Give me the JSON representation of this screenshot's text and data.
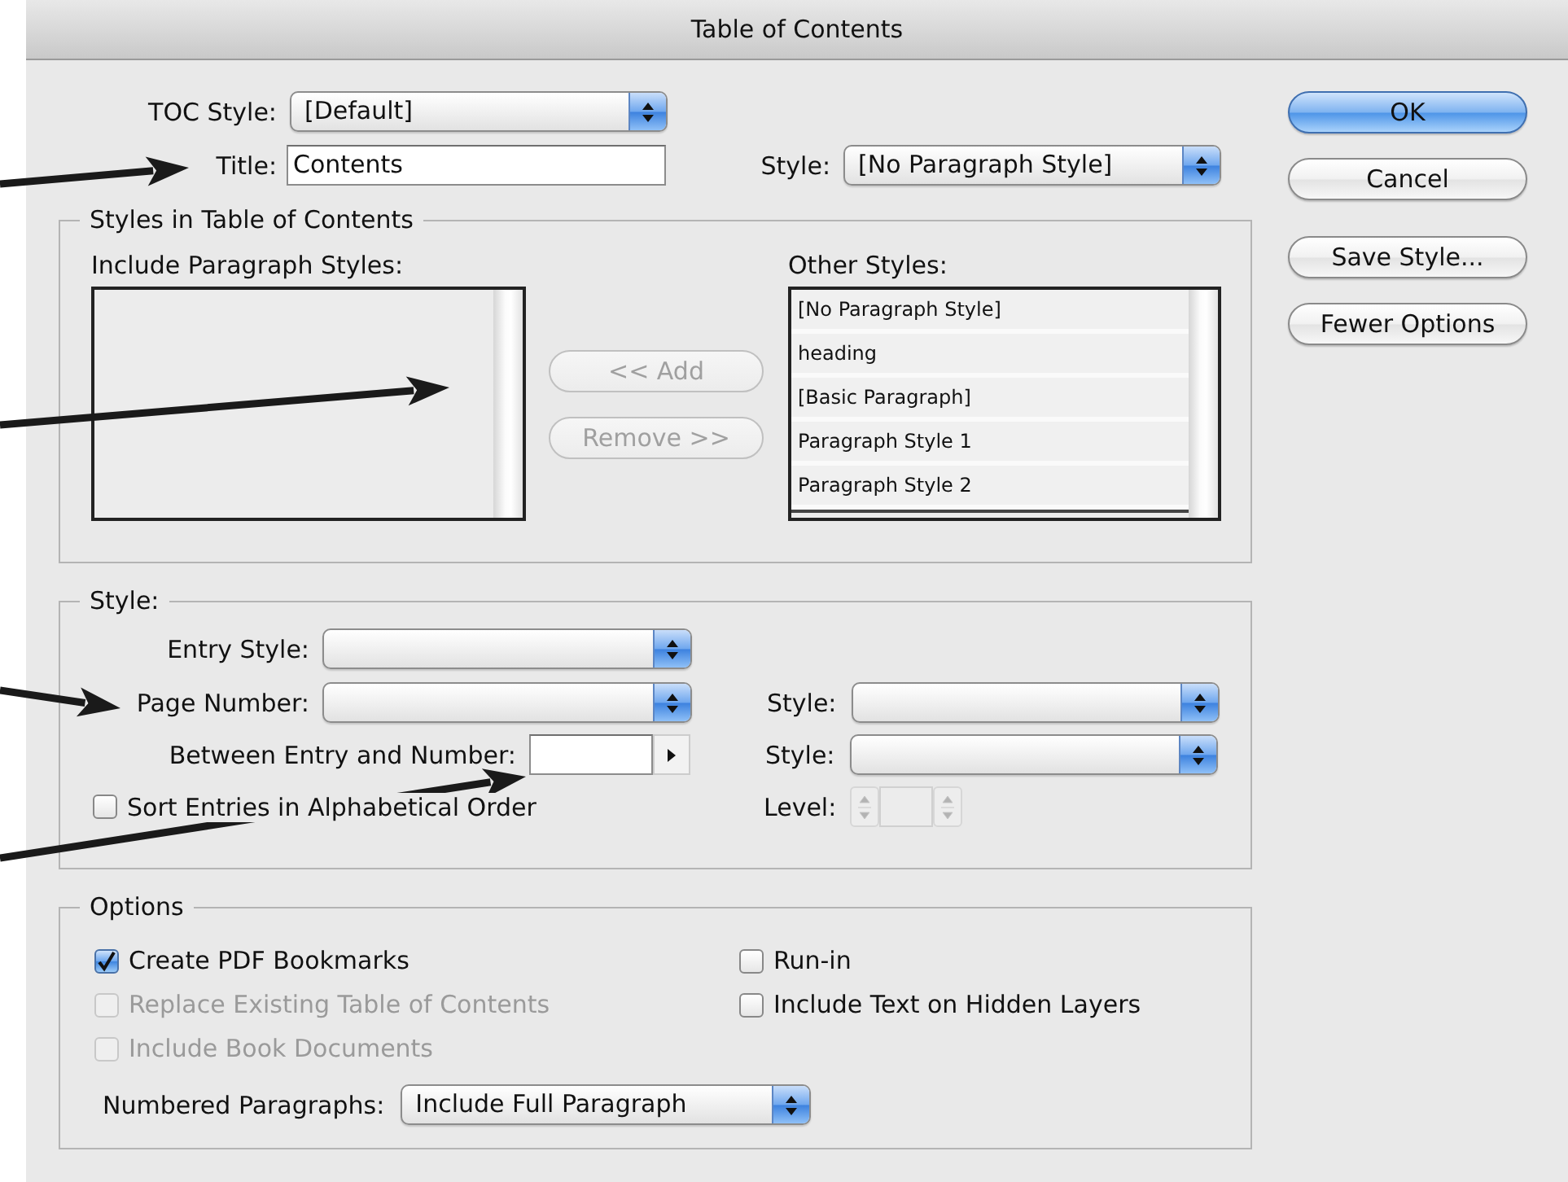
{
  "window": {
    "title": "Table of Contents"
  },
  "toc_style": {
    "label": "TOC Style:",
    "value": "[Default]"
  },
  "title": {
    "label": "Title:",
    "value": "Contents"
  },
  "title_style": {
    "label": "Style:",
    "value": "[No Paragraph Style]"
  },
  "buttons": [
    {
      "label": "OK",
      "default": true
    },
    {
      "label": "Cancel",
      "default": false
    },
    {
      "label": "Save Style...",
      "default": false
    },
    {
      "label": "Fewer Options",
      "default": false
    }
  ],
  "styles_group": {
    "title": "Styles in Table of Contents",
    "include_label": "Include Paragraph Styles:",
    "move_buttons": [
      {
        "label": "<< Add",
        "disabled": true
      },
      {
        "label": "Remove >>",
        "disabled": true
      }
    ],
    "other_label": "Other Styles:",
    "other_items": [
      {
        "label": "[No Paragraph Style]",
        "selected": false
      },
      {
        "label": "heading",
        "selected": false
      },
      {
        "label": "[Basic Paragraph]",
        "selected": false
      },
      {
        "label": "Paragraph Style 1",
        "selected": false
      },
      {
        "label": "Paragraph Style 2",
        "selected": false
      }
    ]
  },
  "style_group": {
    "title": "Style:",
    "entry_style": {
      "label": "Entry Style:"
    },
    "page_number": {
      "label": "Page Number:"
    },
    "page_number_style": {
      "label": "Style:"
    },
    "between": {
      "label": "Between Entry and Number:"
    },
    "between_style": {
      "label": "Style:"
    },
    "sort": {
      "label": "Sort Entries in Alphabetical Order",
      "checked": false
    },
    "level": {
      "label": "Level:",
      "disabled": true
    }
  },
  "options_group": {
    "title": "Options",
    "checkboxes": [
      {
        "label": "Create PDF Bookmarks",
        "checked": true,
        "disabled": false
      },
      {
        "label": "Run-in",
        "checked": false,
        "disabled": false
      },
      {
        "label": "Replace Existing Table of Contents",
        "checked": false,
        "disabled": true
      },
      {
        "label": "Include Text on Hidden Layers",
        "checked": false,
        "disabled": false
      },
      {
        "label": "Include Book Documents",
        "checked": false,
        "disabled": true
      }
    ],
    "numbered": {
      "label": "Numbered Paragraphs:",
      "value": "Include Full Paragraph"
    }
  }
}
